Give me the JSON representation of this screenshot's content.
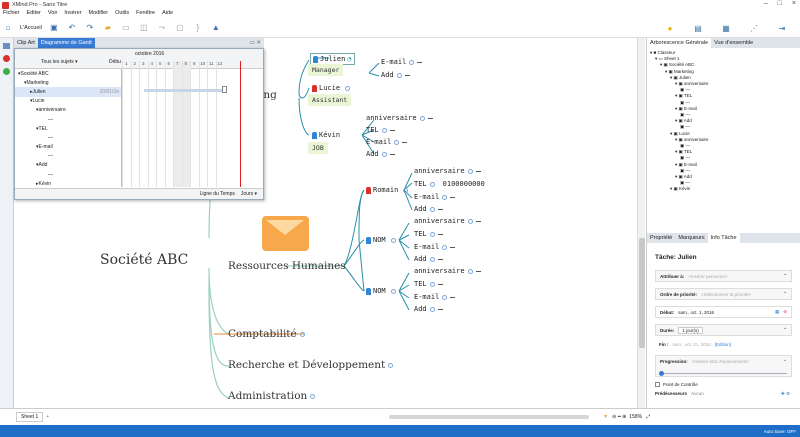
{
  "window": {
    "title": "XMind Pro - Sans Titre"
  },
  "menu": [
    "Fichier",
    "Editer",
    "Voir",
    "Insérer",
    "Modifier",
    "Outils",
    "Fenêtre",
    "Aide"
  ],
  "toolbar": {
    "home_label": "L'Accueil"
  },
  "left_tabs": {
    "clipart": "Clip Art",
    "gantt": "Diagramme de Gantt"
  },
  "gantt": {
    "filter": "Tous les sujets",
    "start_col": "Débu",
    "month": "octobre 2016",
    "days": [
      "1",
      "2",
      "3",
      "4",
      "5",
      "6",
      "7",
      "8",
      "9",
      "10",
      "11",
      "12"
    ],
    "tasks": [
      "Société ABC",
      "Marketing",
      "Julien",
      "Lucie",
      "anniversaire",
      "—",
      "TEL",
      "—",
      "E-mail",
      "—",
      "Add",
      "—",
      "Kévin"
    ],
    "julien_start": "10/01/2e",
    "timeline_label": "Ligne du Temps",
    "unit": "Jours"
  },
  "map": {
    "central": "Société ABC",
    "branches": [
      "Ressources Humaines",
      "Comptabilité",
      "Recherche et Développement",
      "Administration"
    ],
    "marketing_fragment": "ing",
    "julien": "Julien",
    "julien_note": "Manager",
    "lucie": "Lucie",
    "lucie_note": "Assistant",
    "kevin": "Kévin",
    "kevin_note": "JOB",
    "tel_top": "TEL",
    "email": "E-mail",
    "add": "Add",
    "anniv": "anniversaire",
    "tel": "TEL",
    "romain": "Romain",
    "romain_tel_value": "0100000000",
    "nom": "NOM"
  },
  "right_tabs": {
    "overview": "Arborescence Générale",
    "whole": "Vue d'ensemble"
  },
  "outline": [
    "Classeur",
    "Sheet 1",
    "Société ABC",
    "Marketing",
    "Julien",
    "anniversaire",
    "—",
    "TEL",
    "—",
    "E-mail",
    "—",
    "Add",
    "—",
    "Lucie",
    "anniversaire",
    "—",
    "TEL",
    "—",
    "E-mail",
    "—",
    "Add",
    "—",
    "Kévin"
  ],
  "props": {
    "tabs": [
      "Propriété",
      "Marqueurs",
      "Info Tâche"
    ],
    "heading": "Tâche: Julien",
    "assign_label": "Attribuer à:",
    "assign_ph": "<Insérer personne>",
    "priority_label": "Ordre de priorité:",
    "priority_ph": "<Sélectionner la priorité>",
    "start_label": "Début:",
    "start_value": "sam., oct. 1, 2016",
    "duration_label": "Durée:",
    "duration_value": "1 jour(s)",
    "end_label": "Fin :",
    "end_value": "sam., oct. 01, 2016",
    "edit_link": "[Edition]",
    "progress_label": "Progression:",
    "progress_ph": "<Insérer état d'avancement>",
    "milestone": "Point de Contrôle",
    "predecessors": "Prédécesseurs",
    "none": "Aucun"
  },
  "status": {
    "sheet": "Sheet 1",
    "zoom": "158%",
    "autosave": "Auto Save: OFF"
  }
}
